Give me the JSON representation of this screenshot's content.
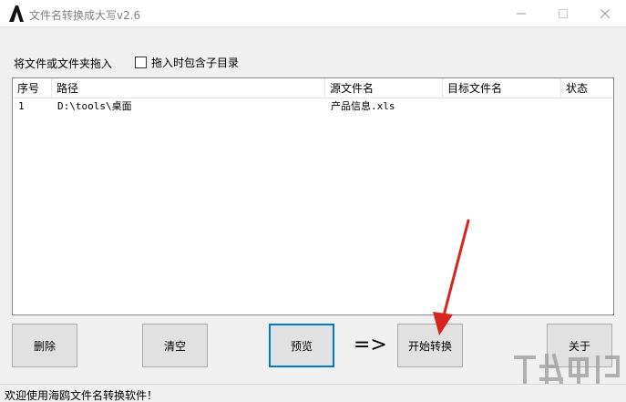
{
  "window": {
    "title": "文件名转换成大写v2.6",
    "icon": "letter-a-icon"
  },
  "toolbar": {
    "drop_label": "将文件或文件夹拖入",
    "include_subdir_label": "拖入时包含子目录",
    "include_subdir_checked": false
  },
  "list": {
    "columns": [
      "序号",
      "路径",
      "源文件名",
      "目标文件名",
      "状态"
    ],
    "rows": [
      {
        "index": "1",
        "path": "D:\\tools\\桌面",
        "source": "产品信息.xls",
        "target": "",
        "status": ""
      }
    ]
  },
  "buttons": {
    "delete": "删除",
    "clear": "清空",
    "preview": "预览",
    "arrow": "=>",
    "start": "开始转换",
    "about": "关于"
  },
  "status": {
    "text": "欢迎使用海鸥文件名转换软件！"
  },
  "colors": {
    "accent": "#0078d7",
    "arrow_red": "#d9231c",
    "title_gray": "#808080"
  }
}
